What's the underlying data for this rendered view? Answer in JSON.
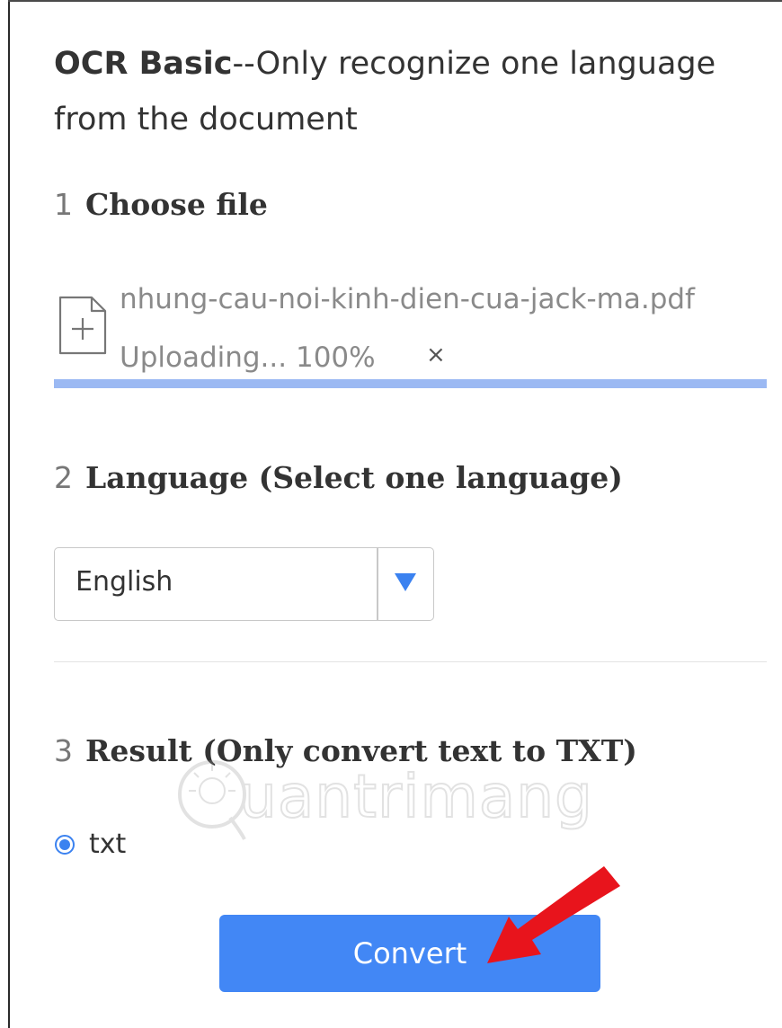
{
  "heading": {
    "bold": "OCR Basic",
    "rest": "--Only recognize one language from the document"
  },
  "steps": [
    {
      "num": "1",
      "label": "Choose file"
    },
    {
      "num": "2",
      "label": "Language (Select one language)"
    },
    {
      "num": "3",
      "label": "Result (Only convert text to TXT)"
    }
  ],
  "upload": {
    "file_name": "nhung-cau-noi-kinh-dien-cua-jack-ma.pdf",
    "status": "Uploading... 100%",
    "remove_glyph": "×",
    "progress_fraction": 1.0
  },
  "language_select": {
    "selected": "English"
  },
  "result": {
    "option_label": "txt",
    "option_selected": true
  },
  "convert_label": "Convert",
  "watermark_text": "uantrimang",
  "colors": {
    "accent": "#4287f5",
    "progress": "#9bb9f3",
    "arrow": "#e8141c"
  },
  "icons": [
    "file-add-icon",
    "close-icon",
    "dropdown-arrow-icon",
    "lightbulb-icon",
    "red-arrow-annotation"
  ]
}
